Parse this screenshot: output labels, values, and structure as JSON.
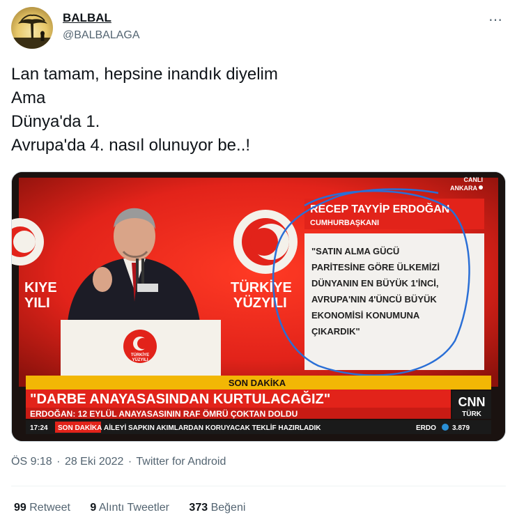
{
  "user": {
    "display_name": "BALBAL",
    "handle": "@BALBALAGA",
    "avatar_icon": "avatar-tree-silhouette"
  },
  "more_icon": "⋯",
  "tweet": {
    "lines": [
      "Lan tamam, hepsine inandık diyelim",
      "Ama",
      "Dünya'da 1.",
      "Avrupa'da 4. nasıl olunuyor be..!"
    ]
  },
  "media": {
    "live_badge": "CANLI",
    "location": "ANKARA",
    "backdrop_left": [
      "KIYE",
      "YILI"
    ],
    "backdrop_right": [
      "TÜRKİYE",
      "YÜZYILI"
    ],
    "podium_logo": [
      "TÜRKİYE",
      "YÜZYILI"
    ],
    "speaker_name": "RECEP TAYYİP ERDOĞAN",
    "speaker_title": "CUMHURBAŞKANI",
    "quote_lines": [
      "\"SATIN ALMA GÜCÜ",
      "PARİTESİNE GÖRE ÜLKEMİZİ",
      "DÜNYANIN EN BÜYÜK 1'İNCİ,",
      "AVRUPA'NIN 4'ÜNCÜ BÜYÜK",
      "EKONOMİSİ KONUMUNA",
      "ÇIKARDIK\""
    ],
    "son_dakika": "SON DAKİKA",
    "headline": "\"DARBE ANAYASASINDAN KURTULACAĞIZ\"",
    "subheadline": "ERDOĞAN: 12 EYLÜL ANAYASASININ RAF ÖMRÜ ÇOKTAN DOLDU",
    "ticker_time": "17:24",
    "ticker_label": "SON DAKİKA",
    "ticker_text": "AİLEYİ SAPKIN AKIMLARDAN KORUYACAK TEKLİF HAZIRLADIK",
    "ticker_right_label": "ERDO",
    "ticker_value": "3.879",
    "channel_logo_top": "CNN",
    "channel_logo_bottom": "TÜRK",
    "colors": {
      "red": "#e2231a",
      "yellow": "#f2b705",
      "dark": "#1a1210",
      "annotation": "#2a6fd6"
    }
  },
  "meta": {
    "time": "ÖS 9:18",
    "date": "28 Eki 2022",
    "source": "Twitter for Android",
    "separator": "·"
  },
  "stats": {
    "retweets_count": "99",
    "retweets_label": "Retweet",
    "quotes_count": "9",
    "quotes_label": "Alıntı Tweetler",
    "likes_count": "373",
    "likes_label": "Beğeni"
  }
}
